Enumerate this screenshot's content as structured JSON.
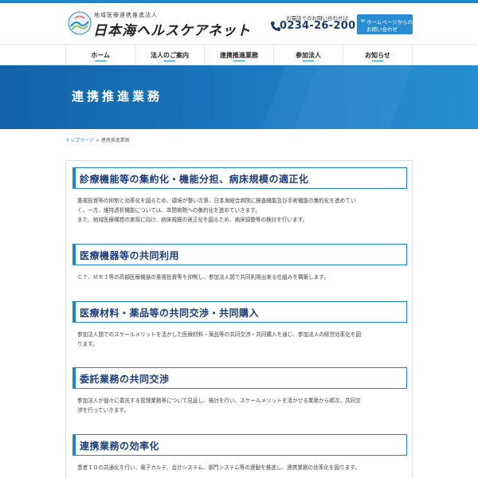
{
  "header": {
    "logo_sub": "地域医療連携推進法人",
    "logo_main": "日本海ヘルスケアネット",
    "phone_label": "お電話でのお問い合わせは",
    "phone_number": "0234-26-2001",
    "contact_line1": "ホームページからの",
    "contact_line2": "お問い合わせ"
  },
  "nav": {
    "items": [
      {
        "label": "ホーム"
      },
      {
        "label": "法人のご案内"
      },
      {
        "label": "連携推進業務"
      },
      {
        "label": "参加法人"
      },
      {
        "label": "お知らせ"
      }
    ]
  },
  "hero": {
    "title": "連携推進業務"
  },
  "breadcrumb": {
    "home": "トップページ",
    "sep": ">",
    "current": "連携推進業務"
  },
  "sections": [
    {
      "title": "診療機能等の集約化・機能分担、病床規模の適正化",
      "lines": [
        "重複投資等の抑制と効率化を図るため、環境が整い次第、日本海総合病院に検査機能及び手術機能の集約化を進めてい",
        "く。一方、維持透析機能については、本間病院への集約化を進めていきます。",
        "また、地域医療構想の実現に向け、病床規模の適正化を図るため、病床調整等の検討を行います。"
      ]
    },
    {
      "title": "医療機器等の共同利用",
      "lines": [
        "ＣＴ、ＭＲＩ等の高額医療機器の重複投資等を抑制し、参加法人間で共同利用出来る仕組みを構築します。"
      ]
    },
    {
      "title": "医療材料・薬品等の共同交渉・共同購入",
      "lines": [
        "参加法人間でのスケールメリットを活かした医療材料・薬品等の共同交渉・共同購入を通じ、参加法人の経営効率化を図",
        "ります。"
      ]
    },
    {
      "title": "委託業務の共同交渉",
      "lines": [
        "参加法人が個々に委託する管理業務等について見直し、検討を行い、スケールメリットを活かせる業務から順次、共同交",
        "渉を行っていきます。"
      ]
    },
    {
      "title": "連携業務の効率化",
      "lines": [
        "患者ＩＤの共通化を行い、電子カルテ、会計システム、部門システム等の連動を推進し、連携業務の効率化を図ります。"
      ]
    }
  ],
  "colors": {
    "accent": "#1a87c9",
    "heading_text": "#1c3d7a",
    "hero_start": "#1462a8",
    "hero_end": "#1a87cf"
  },
  "icons": [
    "logo-mark-icon",
    "phone-icon",
    "mail-icon"
  ]
}
